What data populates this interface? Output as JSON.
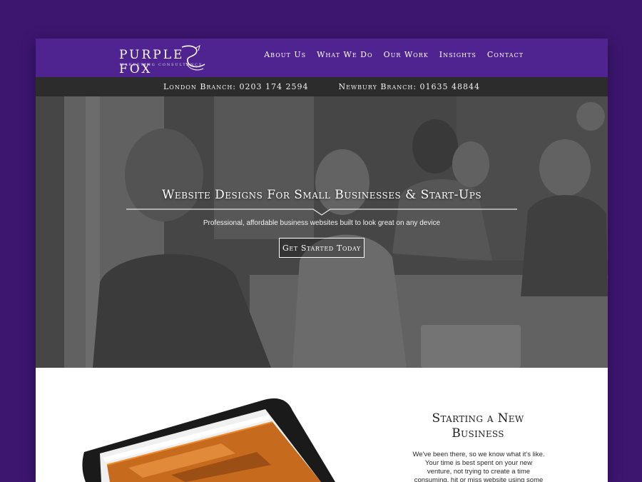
{
  "brand": {
    "name": "PURPLE FOX",
    "tagline": "MARKETING CONSULTANCY",
    "accent_color": "#4f2390",
    "background_color": "#3d1670"
  },
  "nav": {
    "items": [
      {
        "label": "About Us"
      },
      {
        "label": "What We Do"
      },
      {
        "label": "Our Work"
      },
      {
        "label": "Insights"
      },
      {
        "label": "Contact"
      }
    ]
  },
  "branches": {
    "london": "London Branch: 0203 174 2594",
    "newbury": "Newbury Branch: 01635 48844"
  },
  "hero": {
    "title": "Website Designs For Small Businesses & Start-Ups",
    "subtitle": "Professional, affordable business websites built to look great on any device",
    "cta_label": "Get Started Today"
  },
  "section": {
    "title": "Starting a New Business",
    "body": "We've been there, so we know what it's like. Your time is best spent on your new venture, not trying to create a time consuming, hit or miss website using some"
  },
  "icons": {
    "logo_mark": "fox-swirl-icon",
    "rule_marker": "chevron-down-icon"
  }
}
